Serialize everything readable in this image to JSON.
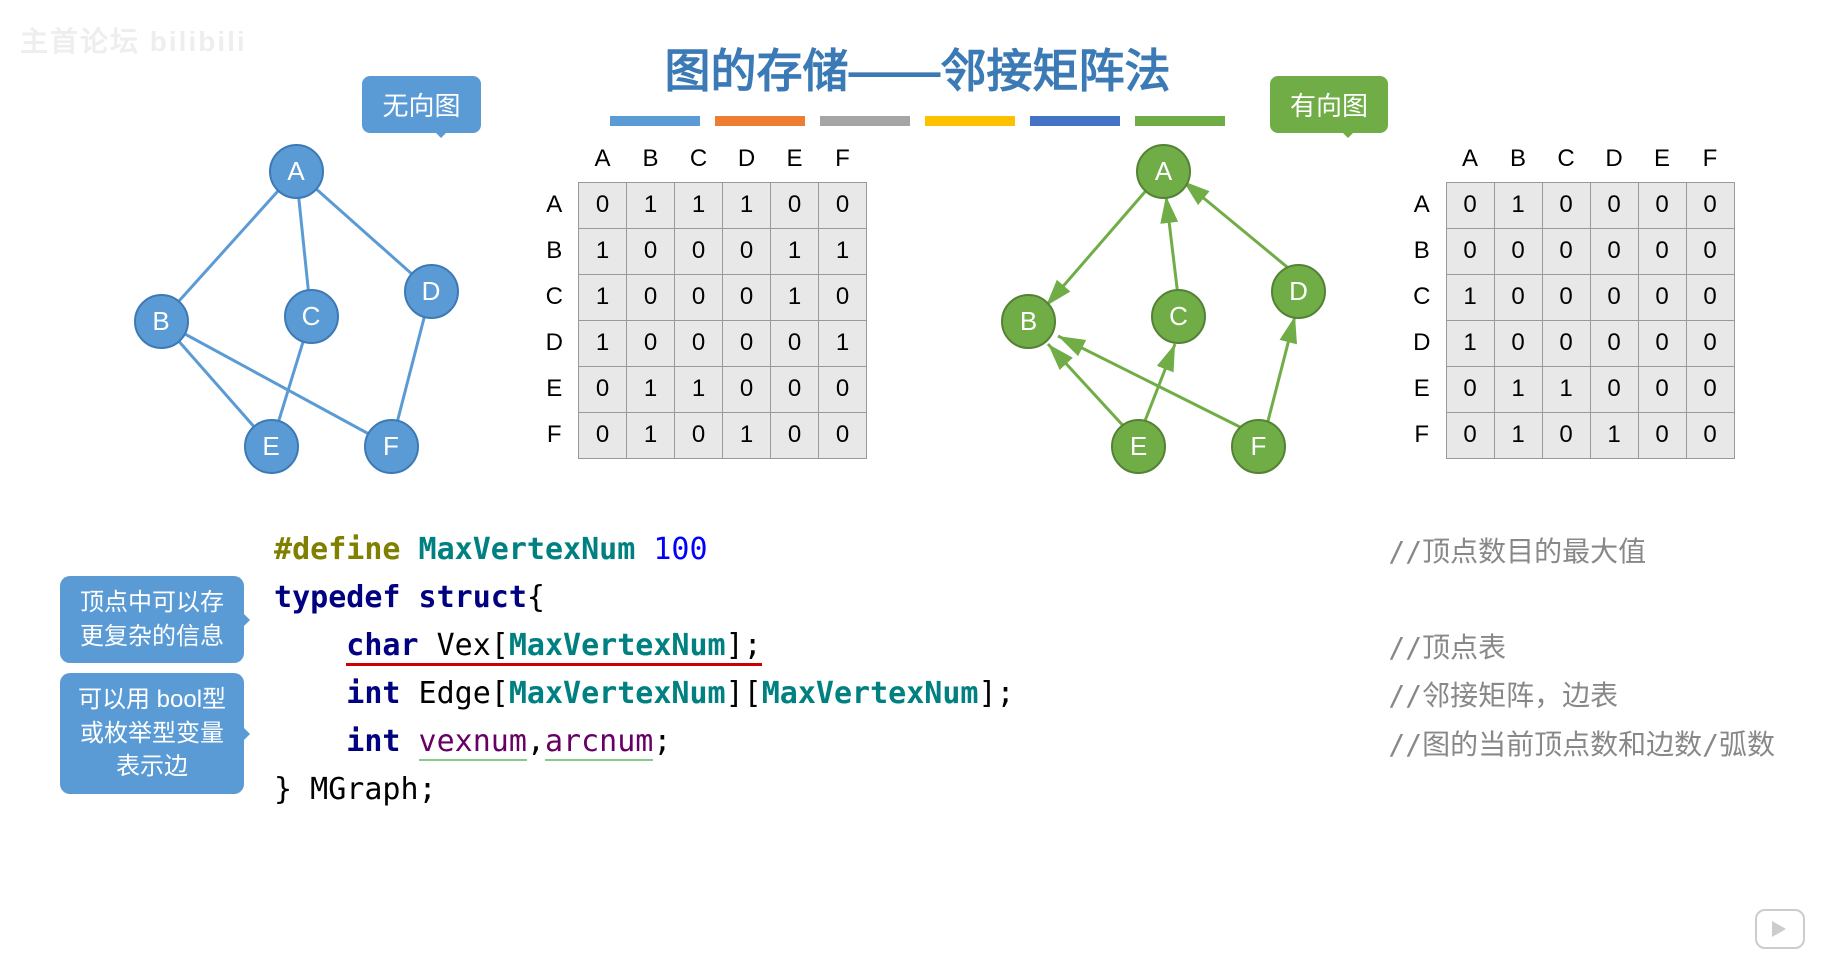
{
  "watermark": "主首论坛 bilibili",
  "title": "图的存储——邻接矩阵法",
  "bars": [
    "#5b9bd5",
    "#ed7d31",
    "#a5a5a5",
    "#ffc000",
    "#4472c4",
    "#70ad47"
  ],
  "left": {
    "tag": "无向图",
    "nodes": [
      "A",
      "B",
      "C",
      "D",
      "E",
      "F"
    ],
    "headers": [
      "A",
      "B",
      "C",
      "D",
      "E",
      "F"
    ],
    "matrix": [
      [
        0,
        1,
        1,
        1,
        0,
        0
      ],
      [
        1,
        0,
        0,
        0,
        1,
        1
      ],
      [
        1,
        0,
        0,
        0,
        1,
        0
      ],
      [
        1,
        0,
        0,
        0,
        0,
        1
      ],
      [
        0,
        1,
        1,
        0,
        0,
        0
      ],
      [
        0,
        1,
        0,
        1,
        0,
        0
      ]
    ]
  },
  "right": {
    "tag": "有向图",
    "nodes": [
      "A",
      "B",
      "C",
      "D",
      "E",
      "F"
    ],
    "headers": [
      "A",
      "B",
      "C",
      "D",
      "E",
      "F"
    ],
    "matrix": [
      [
        0,
        1,
        0,
        0,
        0,
        0
      ],
      [
        0,
        0,
        0,
        0,
        0,
        0
      ],
      [
        1,
        0,
        0,
        0,
        0,
        0
      ],
      [
        1,
        0,
        0,
        0,
        0,
        0
      ],
      [
        0,
        1,
        1,
        0,
        0,
        0
      ],
      [
        0,
        1,
        0,
        1,
        0,
        0
      ]
    ]
  },
  "code": {
    "l1_def": "#define",
    "l1_name": "MaxVertexNum",
    "l1_val": "100",
    "l2_td": "typedef",
    "l2_st": "struct",
    "l2_br": "{",
    "l3_ty": "char",
    "l3_rest": " Vex[",
    "l3_mv": "MaxVertexNum",
    "l3_end": "];",
    "l4_ty": "int",
    "l4_rest": " Edge[",
    "l4_mv1": "MaxVertexNum",
    "l4_mid": "][",
    "l4_mv2": "MaxVertexNum",
    "l4_end": "];",
    "l5_ty": "int",
    "l5_v1": "vexnum",
    "l5_c": ",",
    "l5_v2": "arcnum",
    "l5_end": ";",
    "l6": "} MGraph;"
  },
  "comments": {
    "c1": "//顶点数目的最大值",
    "c2": "",
    "c3": "//顶点表",
    "c4": "//邻接矩阵，边表",
    "c5": "//图的当前顶点数和边数/弧数"
  },
  "bubble1": "顶点中可以存\n更复杂的信息",
  "bubble2": "可以用 bool型\n或枚举型变量\n表示边"
}
